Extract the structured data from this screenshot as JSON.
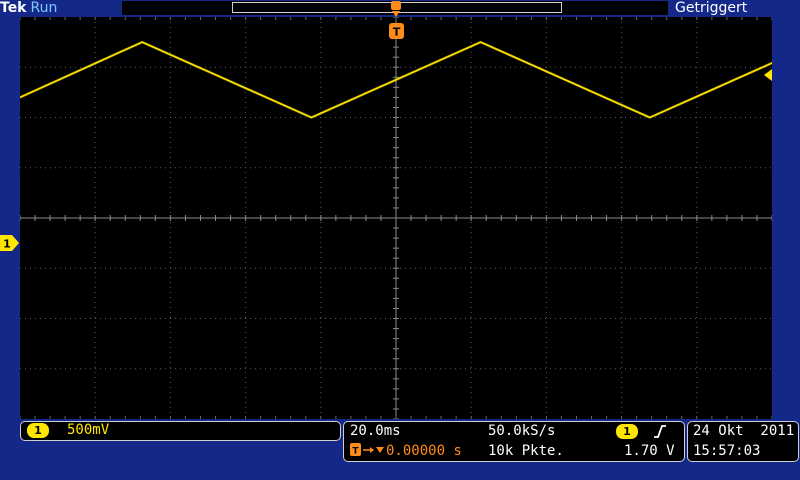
{
  "header": {
    "brand": "Tek",
    "run_state": "Run",
    "trigger_status": "Getriggert",
    "trigger_position_marker": "T"
  },
  "channel": {
    "number": "1",
    "scale": "500mV",
    "color": "#ffe600"
  },
  "timebase": {
    "scale": "20.0ms",
    "sample_rate": "50.0kS/s",
    "record_length": "10k Pkte.",
    "delay": "0.00000 s",
    "trigger_source": "1",
    "trigger_slope_icon": "rising-edge-icon",
    "trigger_level": "1.70 V"
  },
  "clock": {
    "date": "24 Okt  2011",
    "time": "15:57:03"
  },
  "chart_data": {
    "type": "line",
    "title": "",
    "xlabel": "",
    "ylabel": "",
    "grid": true,
    "divisions": {
      "horizontal": 10,
      "vertical": 8
    },
    "x_unit_per_div": "20.0ms",
    "y_unit_per_div": "500mV",
    "xlim_ms": [
      -100,
      100
    ],
    "ylim_V": [
      -2.0,
      2.0
    ],
    "series": [
      {
        "channel": "1",
        "color": "#ffe600",
        "waveform": "triangle",
        "x_ms": [
          -100,
          -67.5,
          -22.5,
          22.5,
          67.5,
          112.5
        ],
        "y_V": [
          1.2,
          1.75,
          1.0,
          1.75,
          1.0,
          1.75
        ]
      }
    ]
  }
}
